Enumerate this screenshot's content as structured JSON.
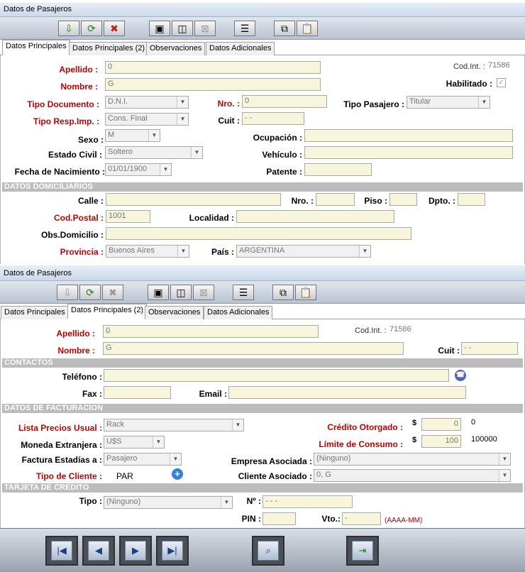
{
  "top": {
    "title": "Datos de Pasajeros",
    "tabs": [
      "Datos Principales",
      "Datos Principales (2)",
      "Observaciones",
      "Datos Adicionales"
    ],
    "labels": {
      "apellido": "Apellido :",
      "nombre": "Nombre :",
      "cod_int": "Cod.Int. :",
      "habilitado": "Habilitado :",
      "tipo_doc": "Tipo Documento  :",
      "nro": "Nro. :",
      "tipo_pasajero": "Tipo Pasajero :",
      "tipo_resp": "Tipo Resp.Imp. :",
      "cuit": "Cuit :",
      "sexo": "Sexo :",
      "ocupacion": "Ocupación :",
      "estado_civil": "Estado Civil :",
      "vehiculo": "Vehículo :",
      "fecha_nac": "Fecha de Nacimiento :",
      "patente": "Patente :",
      "calle": "Calle :",
      "nro2": "Nro. :",
      "piso": "Piso :",
      "dpto": "Dpto. :",
      "cod_postal": "Cod.Postal :",
      "localidad": "Localidad :",
      "obs_domicilio": "Obs.Domicilio :",
      "provincia": "Provincia :",
      "pais": "País :"
    },
    "values": {
      "apellido": "0",
      "nombre": "G",
      "cod_int": "71586",
      "habilitado_mark": "✓",
      "tipo_doc": "D.N.I.",
      "nro": "0",
      "tipo_pasajero": "Titular",
      "tipo_resp": "Cons. Final",
      "cuit": "-        -",
      "sexo": "M",
      "ocupacion": "",
      "estado_civil": "Soltero",
      "vehiculo": "",
      "fecha_nac": "01/01/1900",
      "patente": "",
      "calle": "",
      "nro2": "",
      "piso": "",
      "dpto": "",
      "cod_postal": "1001",
      "localidad": "",
      "obs_domicilio": "",
      "provincia": "Buenos Aires",
      "pais": "ARGENTINA"
    },
    "section_domicilio": "DATOS DOMICILIARIOS"
  },
  "bottom": {
    "title": "Datos de Pasajeros",
    "tabs": [
      "Datos Principales",
      "Datos Principales (2)",
      "Observaciones",
      "Datos Adicionales"
    ],
    "labels": {
      "apellido": "Apellido :",
      "nombre": "Nombre :",
      "cod_int": "Cod.Int. :",
      "cuit": "Cuit :",
      "telefono": "Teléfono :",
      "fax": "Fax :",
      "email": "Email :",
      "lista_precios": "Lista Precios Usual :",
      "credito": "Crédito Otorgado :",
      "moneda": "Moneda Extranjera :",
      "limite": "Límite de Consumo :",
      "factura": "Factura Estadías a :",
      "empresa": "Empresa Asociada :",
      "tipo_cliente": "Tipo de Cliente :",
      "cliente_asociado": "Cliente Asociado :",
      "tipo": "Tipo :",
      "nro": "Nº :",
      "pin": "PIN :",
      "vto": "Vto.:"
    },
    "values": {
      "apellido": "0",
      "nombre": "G",
      "cod_int": "71586",
      "cuit": "-        -",
      "telefono": "",
      "fax": "",
      "email": "",
      "lista_precios": "Rack",
      "currency_symbol": "$",
      "credito": "0",
      "credito_text": "0",
      "moneda": "U$S",
      "limite": "100",
      "limite_text": "100000",
      "factura": "Pasajero",
      "empresa": "(Ninguno)",
      "tipo_cliente": "PAR",
      "cliente_asociado": "0, G",
      "tipo": "(Ninguno)",
      "nro": "-     -     -",
      "pin": "",
      "vto": "-",
      "vto_hint": "(AAAA-MM)"
    },
    "section_contactos": "CONTACTOS",
    "section_facturacion": "DATOS DE FACTURACION",
    "section_tarjeta": "TARJETA DE CREDITO"
  },
  "colors": {
    "required_label": "#c00000",
    "field_bg": "#f7f6dc",
    "section_bg": "#bcbcbc"
  }
}
